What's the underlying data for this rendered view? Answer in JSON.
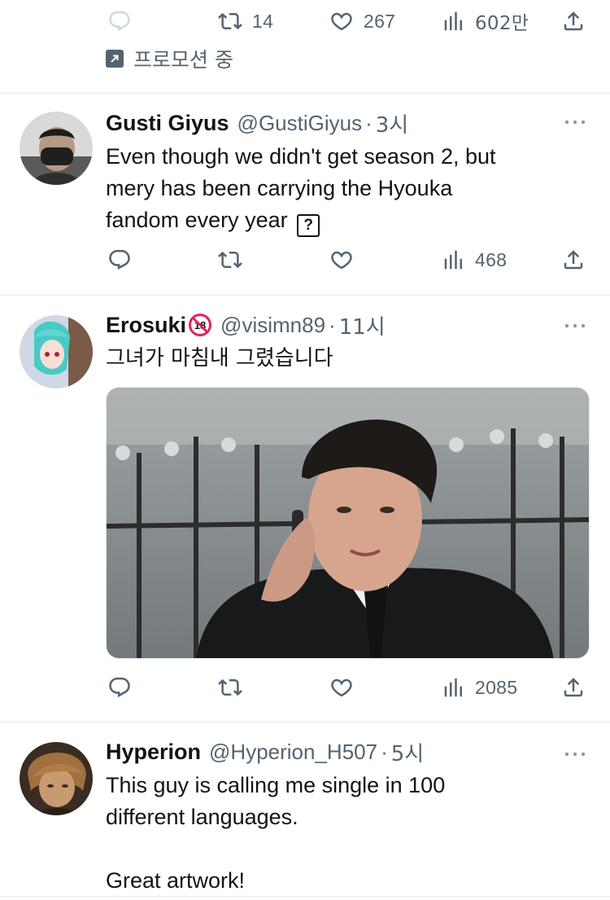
{
  "top_tweet": {
    "actions": {
      "retweets": "14",
      "likes": "267",
      "views": "602만"
    },
    "promoted_label": "프로모션 중"
  },
  "replies": [
    {
      "name": "Gusti Giyus",
      "handle": "@GustiGiyus",
      "separator": "·",
      "time": "3시",
      "text": "Even though we didn't get season 2, but\nmery has been carrying the Hyouka\nfandom every year",
      "emoji_glyph": "?",
      "actions": {
        "views": "468"
      }
    },
    {
      "name": "Erosuki",
      "handle": "@visimn89",
      "separator": "·",
      "time": "11시",
      "badge": "18",
      "text": "그녀가 마침내 그렸습니다",
      "actions": {
        "views": "2085"
      }
    },
    {
      "name": "Hyperion",
      "handle": "@Hyperion_H507",
      "separator": "·",
      "time": "5시",
      "text": "This guy is calling me single in 100\ndifferent languages.\n\nGreat artwork!"
    }
  ],
  "colors": {
    "text_primary": "#0f1419",
    "text_secondary": "#536471",
    "divider": "#e6e9ec",
    "badge_red": "#e0245e"
  },
  "icons": [
    "reply-icon",
    "retweet-icon",
    "like-icon",
    "views-icon",
    "share-icon",
    "more-icon",
    "promoted-icon"
  ]
}
